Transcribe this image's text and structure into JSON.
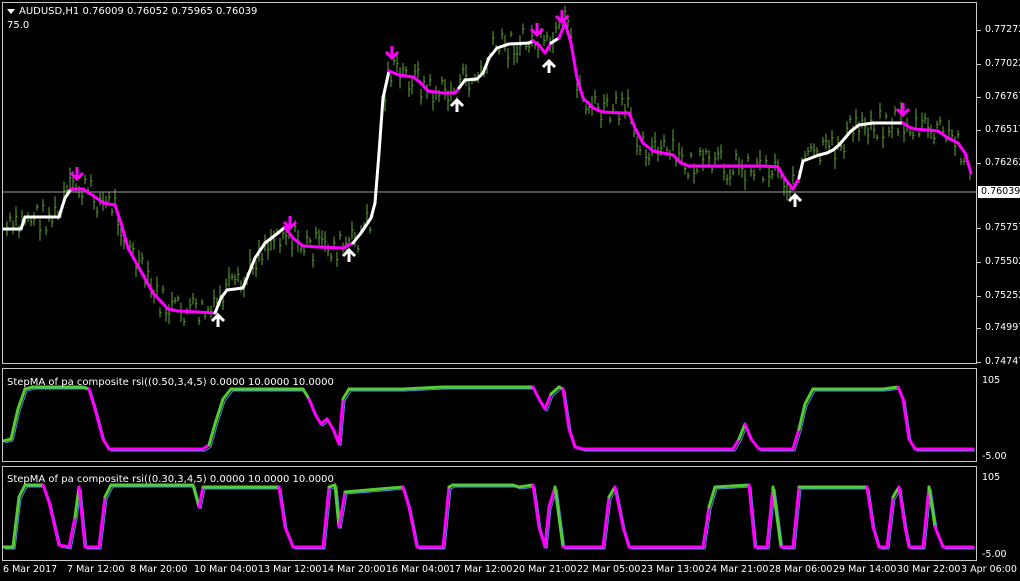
{
  "header": {
    "symbol_line": "AUDUSD,H1  0.76009 0.76052 0.75965 0.76039",
    "value": "75.0"
  },
  "price_axis": {
    "labels": [
      "0.77272",
      "0.77022",
      "0.76767",
      "0.76517",
      "0.76262",
      "0.76039",
      "0.75757",
      "0.75502",
      "0.75252",
      "0.74997",
      "0.74747"
    ],
    "current": "0.76039"
  },
  "sub1": {
    "title": "StepMA of pa composite rsi((0.50,3,4,5) 0.0000 10.0000 10.0000",
    "top": "105",
    "bottom": "-5.00"
  },
  "sub2": {
    "title": "StepMA of pa composite rsi((0.30,3,4,5) 0.0000 10.0000 10.0000",
    "top": "105",
    "bottom": "-5.00"
  },
  "time_axis": [
    "6 Mar 2017",
    "7 Mar 12:00",
    "8 Mar 20:00",
    "10 Mar 04:00",
    "13 Mar 12:00",
    "14 Mar 20:00",
    "16 Mar 04:00",
    "17 Mar 12:00",
    "20 Mar 21:00",
    "22 Mar 05:00",
    "23 Mar 13:00",
    "24 Mar 21:00",
    "28 Mar 06:00",
    "29 Mar 14:00",
    "30 Mar 22:00",
    "3 Apr 06:00"
  ],
  "colors": {
    "bars": "#5fa832",
    "up_line": "#ffffff",
    "down_line": "#ff00ff",
    "osc_green": "#55cc33",
    "osc_magenta": "#ff00ff",
    "osc_blue": "#4a90d9"
  }
}
